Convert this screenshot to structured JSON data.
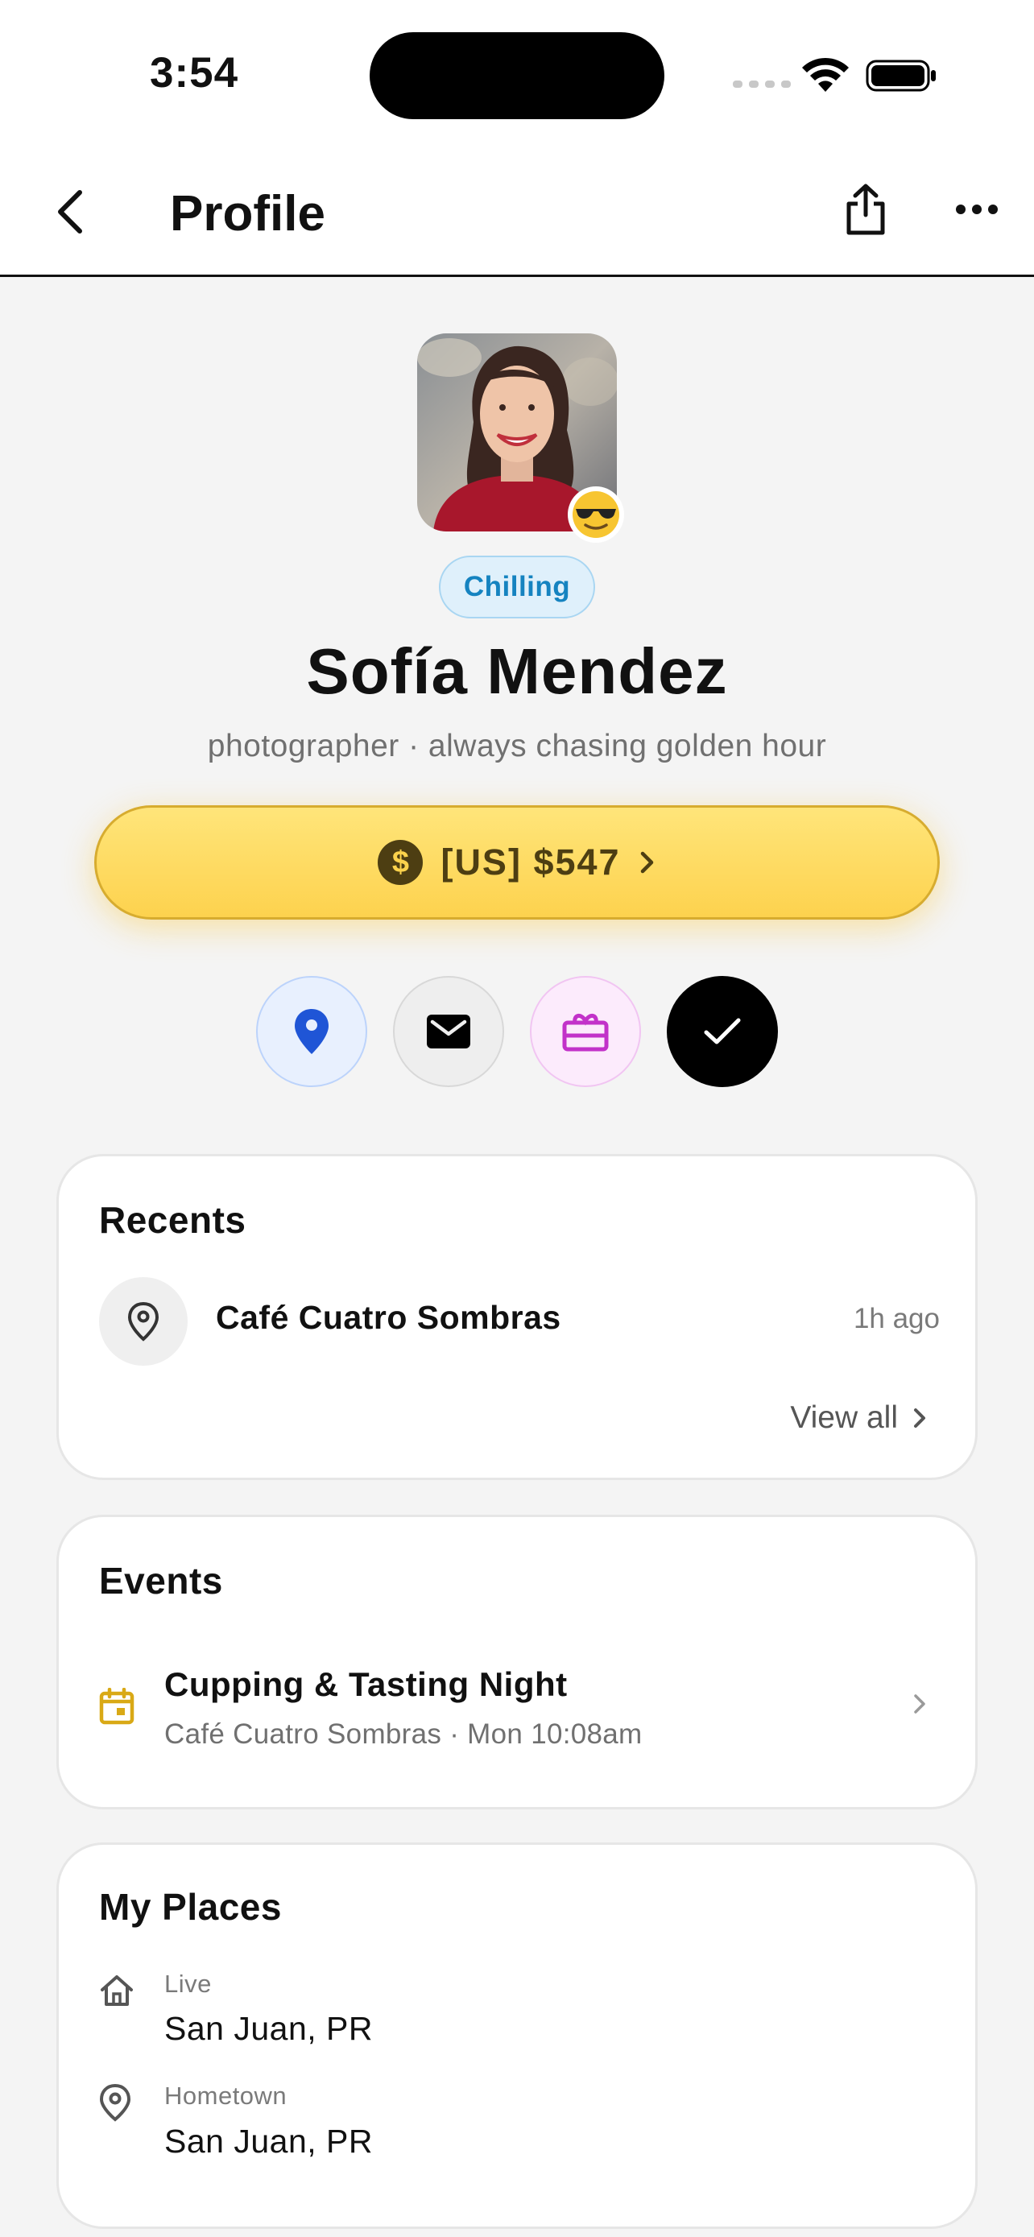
{
  "status_bar": {
    "time": "3:54"
  },
  "nav": {
    "title": "Profile"
  },
  "profile": {
    "mood": "Chilling",
    "name": "Sofía Mendez",
    "bio": "photographer · always chasing golden hour",
    "emoji": "😎"
  },
  "balance": {
    "label": "[US] $547",
    "coin_symbol": "$"
  },
  "actions": [
    {
      "icon": "location-pin-icon",
      "color": "#1f55d6"
    },
    {
      "icon": "mail-icon",
      "color": "#000000"
    },
    {
      "icon": "gift-card-icon",
      "color": "#c232c9"
    },
    {
      "icon": "checkmark-icon",
      "color": "#ffffff"
    }
  ],
  "recents": {
    "title": "Recents",
    "items": [
      {
        "name": "Café Cuatro Sombras",
        "time": "1h ago"
      }
    ],
    "view_all": "View all"
  },
  "events": {
    "title": "Events",
    "items": [
      {
        "title": "Cupping & Tasting Night",
        "subtitle": "Café Cuatro Sombras · Mon 10:08am"
      }
    ]
  },
  "places": {
    "title": "My Places",
    "items": [
      {
        "label": "Live",
        "value": "San Juan, PR",
        "icon": "home-icon"
      },
      {
        "label": "Hometown",
        "value": "San Juan, PR",
        "icon": "location-pin-icon"
      }
    ]
  },
  "colors": {
    "accent_yellow": "#fdd24e",
    "event_icon": "#d9a916",
    "mood_blue": "#1583c0"
  }
}
